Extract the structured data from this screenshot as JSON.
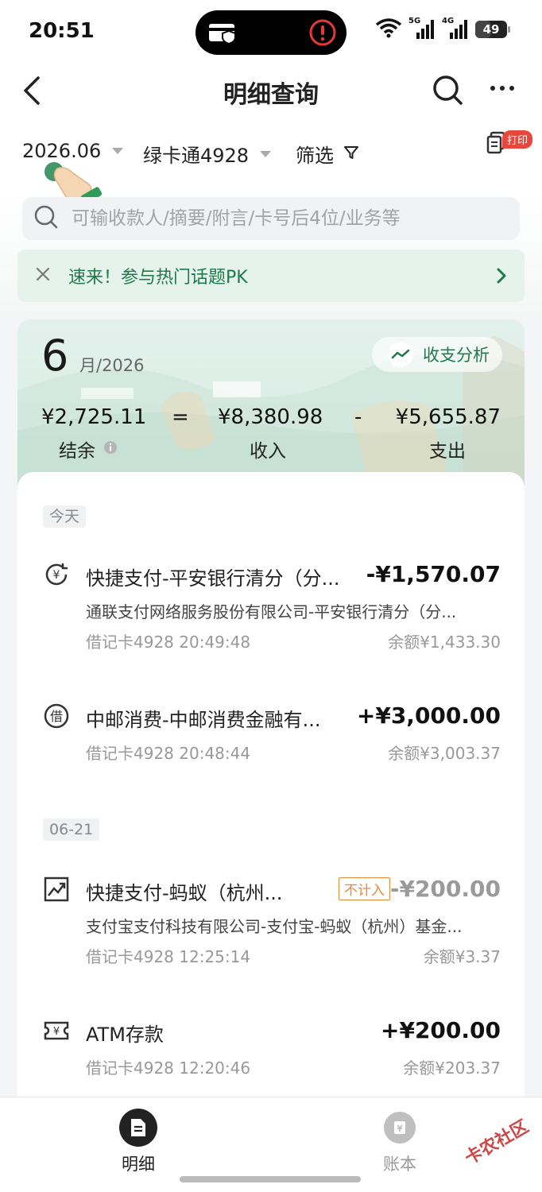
{
  "status_bar": {
    "time": "20:51",
    "network_1": "5G",
    "network_2": "4G",
    "battery": "49",
    "battery_level_percent": 49
  },
  "header": {
    "title": "明细查询"
  },
  "filters": {
    "date": "2026.06",
    "card": "绿卡通4928",
    "screen": "筛选",
    "print_badge": "打印"
  },
  "search": {
    "placeholder": "可输收款人/摘要/附言/卡号后4位/业务等"
  },
  "promo": {
    "text": "速来！参与热门话题PK"
  },
  "summary": {
    "month": "6",
    "year_suffix": "月/2026",
    "analysis_label": "收支分析",
    "balance_amount": "¥2,725.11",
    "eq": "=",
    "income_amount": "¥8,380.98",
    "minus": "-",
    "expense_amount": "¥5,655.87",
    "balance_label": "结余",
    "income_label": "收入",
    "expense_label": "支出"
  },
  "days": [
    {
      "tag": "今天",
      "transactions": [
        {
          "icon": "yuan-refresh-icon",
          "title": "快捷支付-平安银行清分（分...",
          "amount": "-¥1,570.07",
          "sub": "通联支付网络服务股份有限公司-平安银行清分（分...",
          "meta": "借记卡4928 20:49:48",
          "balance": "余额¥1,433.30"
        },
        {
          "icon": "loan-icon",
          "title": "中邮消费-中邮消费金融有...",
          "amount": "+¥3,000.00",
          "meta": "借记卡4928 20:48:44",
          "balance": "余额¥3,003.37"
        }
      ]
    },
    {
      "tag": "06-21",
      "transactions": [
        {
          "icon": "trend-icon",
          "title": "快捷支付-蚂蚁（杭州...",
          "badge": "不计入",
          "amount": "-¥200.00",
          "sub": "支付宝支付科技有限公司-支付宝-蚂蚁（杭州）基金...",
          "meta": "借记卡4928 12:25:14",
          "balance": "余额¥3.37"
        },
        {
          "icon": "atm-icon",
          "title": "ATM存款",
          "amount": "+¥200.00",
          "meta": "借记卡4928 12:20:46",
          "balance": "余额¥203.37"
        }
      ]
    }
  ],
  "tabbar": {
    "detail": "明细",
    "book": "账本"
  },
  "watermark": "卡农社区",
  "colors": {
    "accent_green": "#1f7a4a",
    "badge_orange": "#e8893a",
    "print_badge_red": "#e8483b"
  }
}
